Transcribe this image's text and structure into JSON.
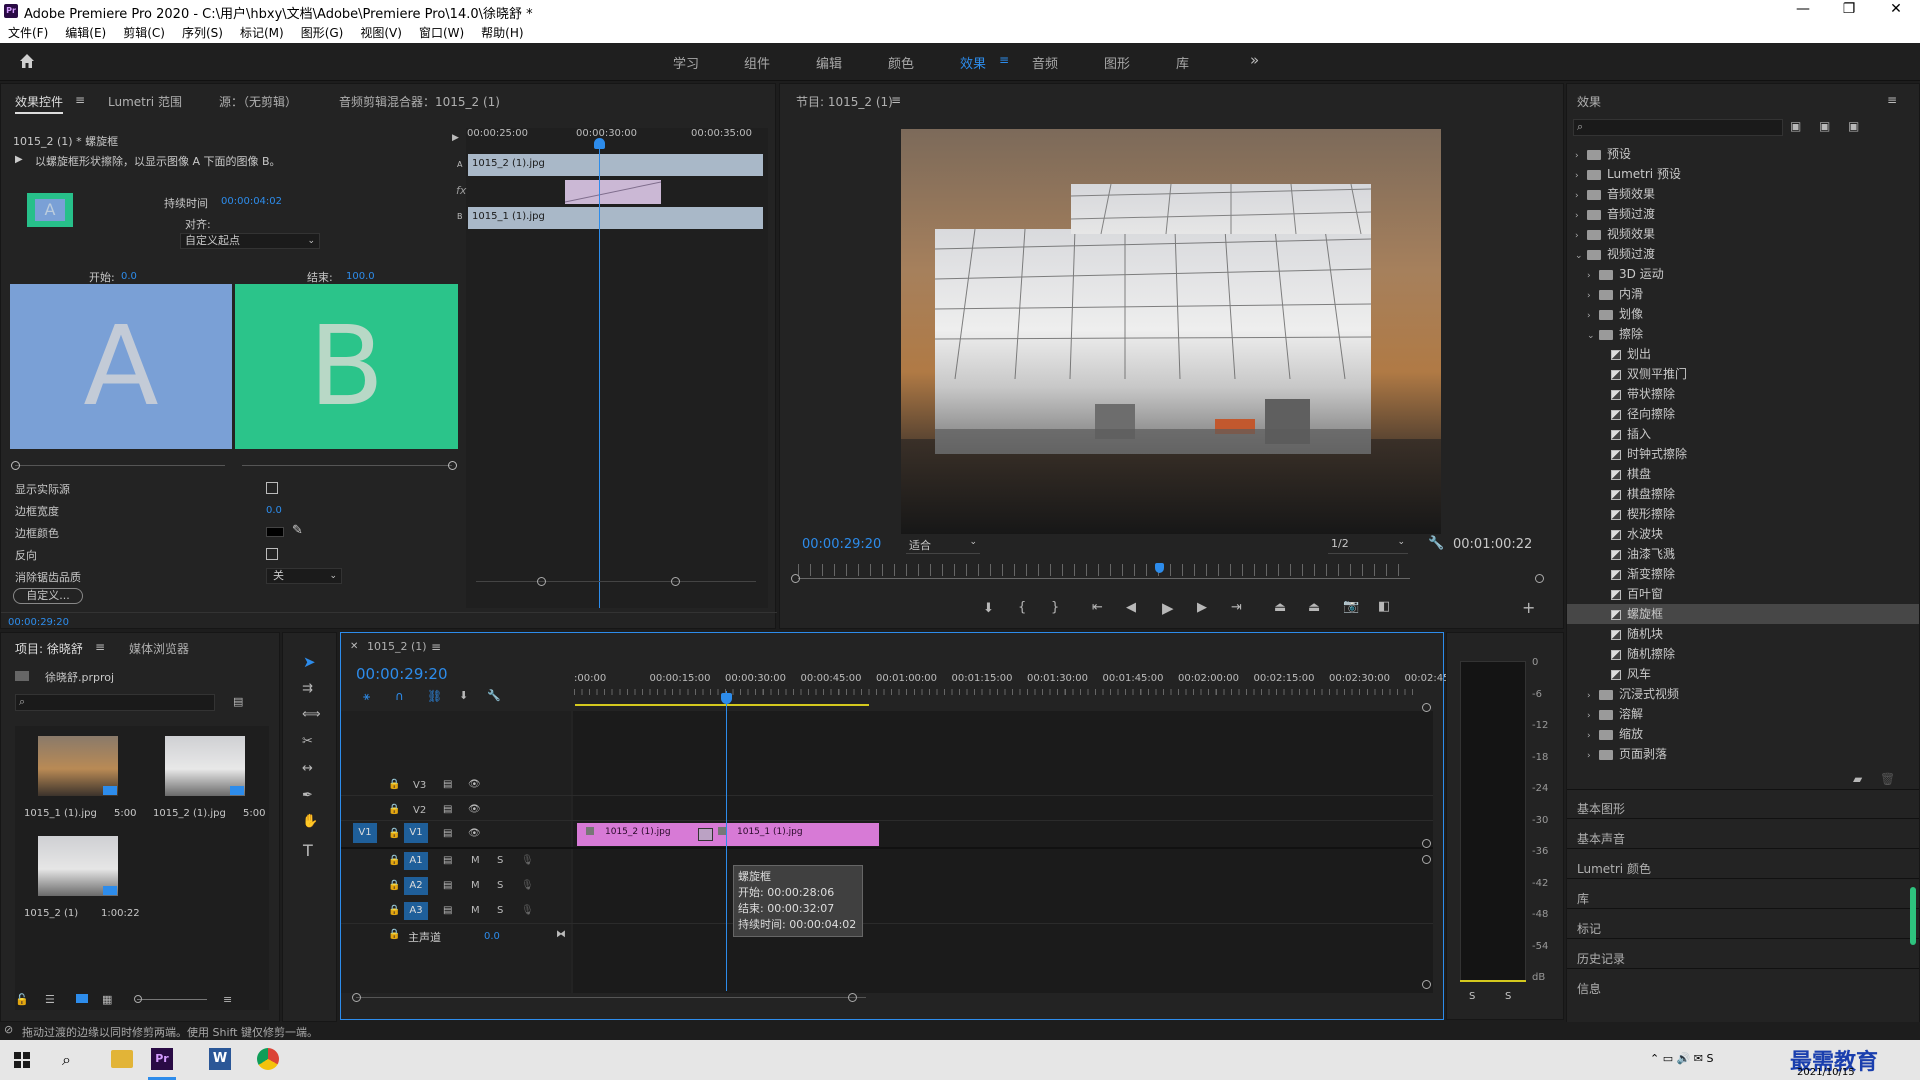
{
  "window": {
    "title": "Adobe Premiere Pro 2020 - C:\\用户\\hbxy\\文档\\Adobe\\Premiere Pro\\14.0\\徐晓舒 *",
    "logo": "Pr",
    "controls": [
      "—",
      "❐",
      "✕"
    ]
  },
  "menu": [
    "文件(F)",
    "编辑(E)",
    "剪辑(C)",
    "序列(S)",
    "标记(M)",
    "图形(G)",
    "视图(V)",
    "窗口(W)",
    "帮助(H)"
  ],
  "workspaces": [
    "学习",
    "组件",
    "编辑",
    "颜色",
    "效果",
    "音频",
    "图形",
    "库"
  ],
  "workspace_active": "效果",
  "effect_controls": {
    "tabs": [
      "效果控件",
      "Lumetri 范围",
      "源：（无剪辑）",
      "音频剪辑混合器：1015_2 (1)"
    ],
    "clip_label": "1015_2 (1) * 螺旋框",
    "description": "以螺旋框形状擦除，以显示图像 A 下面的图像 B。",
    "thumb_letter": "A",
    "duration_label": "持续时间",
    "duration_value": "00:00:04:02",
    "align_label": "对齐:",
    "align_value": "自定义起点",
    "start_label": "开始:",
    "start_value": "0.0",
    "end_label": "结束:",
    "end_value": "100.0",
    "preview_a": "A",
    "preview_b": "B",
    "props": [
      {
        "label": "显示实际源",
        "type": "checkbox"
      },
      {
        "label": "边框宽度",
        "type": "value",
        "value": "0.0"
      },
      {
        "label": "边框颜色",
        "type": "color"
      },
      {
        "label": "反向",
        "type": "checkbox"
      },
      {
        "label": "消除锯齿品质",
        "type": "select",
        "value": "关"
      }
    ],
    "custom_button": "自定义...",
    "timecode": "00:00:29:20",
    "mini_ruler": [
      "00:00:25:00",
      "00:00:30:00",
      "00:00:35:00"
    ],
    "clip_a": "1015_2 (1).jpg",
    "clip_b": "1015_1 (1).jpg",
    "track_a": "A",
    "track_b": "B",
    "fx_mark": "fx"
  },
  "program": {
    "title": "节目: 1015_2 (1)",
    "timecode": "00:00:29:20",
    "fit": "适合",
    "quality": "1/2",
    "duration": "00:01:00:22"
  },
  "effects_panel": {
    "title": "效果",
    "tree": [
      {
        "label": "预设",
        "level": 0,
        "kind": "folder",
        "open": false
      },
      {
        "label": "Lumetri 预设",
        "level": 0,
        "kind": "folder",
        "open": false
      },
      {
        "label": "音频效果",
        "level": 0,
        "kind": "folder",
        "open": false
      },
      {
        "label": "音频过渡",
        "level": 0,
        "kind": "folder",
        "open": false
      },
      {
        "label": "视频效果",
        "level": 0,
        "kind": "folder",
        "open": false
      },
      {
        "label": "视频过渡",
        "level": 0,
        "kind": "folder",
        "open": true
      },
      {
        "label": "3D 运动",
        "level": 1,
        "kind": "folder",
        "open": false
      },
      {
        "label": "内滑",
        "level": 1,
        "kind": "folder",
        "open": false
      },
      {
        "label": "划像",
        "level": 1,
        "kind": "folder",
        "open": false
      },
      {
        "label": "擦除",
        "level": 1,
        "kind": "folder",
        "open": true
      },
      {
        "label": "划出",
        "level": 2,
        "kind": "fx"
      },
      {
        "label": "双侧平推门",
        "level": 2,
        "kind": "fx"
      },
      {
        "label": "带状擦除",
        "level": 2,
        "kind": "fx"
      },
      {
        "label": "径向擦除",
        "level": 2,
        "kind": "fx"
      },
      {
        "label": "插入",
        "level": 2,
        "kind": "fx"
      },
      {
        "label": "时钟式擦除",
        "level": 2,
        "kind": "fx"
      },
      {
        "label": "棋盘",
        "level": 2,
        "kind": "fx"
      },
      {
        "label": "棋盘擦除",
        "level": 2,
        "kind": "fx"
      },
      {
        "label": "楔形擦除",
        "level": 2,
        "kind": "fx"
      },
      {
        "label": "水波块",
        "level": 2,
        "kind": "fx"
      },
      {
        "label": "油漆飞溅",
        "level": 2,
        "kind": "fx"
      },
      {
        "label": "渐变擦除",
        "level": 2,
        "kind": "fx"
      },
      {
        "label": "百叶窗",
        "level": 2,
        "kind": "fx"
      },
      {
        "label": "螺旋框",
        "level": 2,
        "kind": "fx",
        "selected": true
      },
      {
        "label": "随机块",
        "level": 2,
        "kind": "fx"
      },
      {
        "label": "随机擦除",
        "level": 2,
        "kind": "fx"
      },
      {
        "label": "风车",
        "level": 2,
        "kind": "fx"
      },
      {
        "label": "沉浸式视频",
        "level": 1,
        "kind": "folder",
        "open": false
      },
      {
        "label": "溶解",
        "level": 1,
        "kind": "folder",
        "open": false
      },
      {
        "label": "缩放",
        "level": 1,
        "kind": "folder",
        "open": false
      },
      {
        "label": "页面剥落",
        "level": 1,
        "kind": "folder",
        "open": false
      }
    ],
    "sections": [
      "基本图形",
      "基本声音",
      "Lumetri 颜色",
      "库",
      "标记",
      "历史记录",
      "信息"
    ]
  },
  "project": {
    "tabs": [
      "项目: 徐晓舒",
      "媒体浏览器"
    ],
    "file": "徐晓舒.prproj",
    "items": [
      {
        "name": "1015_1 (1).jpg",
        "dur": "5:00"
      },
      {
        "name": "1015_2 (1).jpg",
        "dur": "5:00"
      },
      {
        "name": "1015_2 (1)",
        "dur": "1:00:22"
      }
    ]
  },
  "timeline": {
    "tab": "1015_2 (1)",
    "timecode": "00:00:29:20",
    "ruler": [
      ":00:00",
      "00:00:15:00",
      "00:00:30:00",
      "00:00:45:00",
      "00:01:00:00",
      "00:01:15:00",
      "00:01:30:00",
      "00:01:45:00",
      "00:02:00:00",
      "00:02:15:00",
      "00:02:30:00",
      "00:02:45:"
    ],
    "video_tracks": [
      "V3",
      "V2",
      "V1"
    ],
    "audio_tracks": [
      "A1",
      "A2",
      "A3"
    ],
    "src_v": "V1",
    "master": "主声道",
    "master_val": "0.0",
    "clip1": "1015_2 (1).jpg",
    "clip2": "1015_1 (1).jpg",
    "tooltip": {
      "name": "螺旋框",
      "start": "开始: 00:00:28:06",
      "end": "结束: 00:00:32:07",
      "dur": "持续时间: 00:00:04:02"
    }
  },
  "meter": {
    "labels": [
      "0",
      "-6",
      "-12",
      "-18",
      "-24",
      "-30",
      "-36",
      "-42",
      "-48",
      "-54",
      "dB"
    ],
    "solo": [
      "S",
      "S"
    ]
  },
  "status": "拖动过渡的边缘以同时修剪两端。使用 Shift 键仅修剪一端。",
  "taskbar": {
    "date": "2021/10/15",
    "brand": "最需教育"
  },
  "colors": {
    "accent": "#2d8ceb",
    "clip": "#d77ad6",
    "a_panel": "#7aa0d6",
    "b_panel": "#2bc48a"
  }
}
